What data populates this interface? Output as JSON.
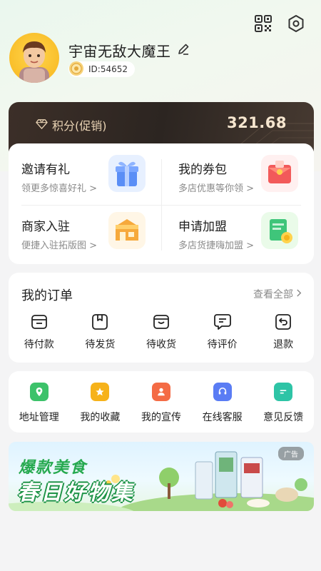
{
  "profile": {
    "username": "宇宙无敌大魔王",
    "id_text": "ID:54652"
  },
  "points": {
    "label": "积分(促销)",
    "value": "321.68"
  },
  "promos": [
    {
      "title": "邀请有礼",
      "subtitle": "领更多惊喜好礼 >"
    },
    {
      "title": "我的券包",
      "subtitle": "多店优惠等你领 >"
    },
    {
      "title": "商家入驻",
      "subtitle": "便捷入驻拓版图 >"
    },
    {
      "title": "申请加盟",
      "subtitle": "多店货捷嗨加盟 >"
    }
  ],
  "orders": {
    "title": "我的订单",
    "view_all": "查看全部",
    "items": [
      {
        "label": "待付款",
        "icon": "wallet-icon"
      },
      {
        "label": "待发货",
        "icon": "package-icon"
      },
      {
        "label": "待收货",
        "icon": "box-icon"
      },
      {
        "label": "待评价",
        "icon": "comment-icon"
      },
      {
        "label": "退款",
        "icon": "refund-icon"
      }
    ]
  },
  "tools": [
    {
      "label": "地址管理",
      "icon": "location-icon",
      "color": "#3cc26a"
    },
    {
      "label": "我的收藏",
      "icon": "star-icon",
      "color": "#f6b21a"
    },
    {
      "label": "我的宣传",
      "icon": "person-icon",
      "color": "#f46b45"
    },
    {
      "label": "在线客服",
      "icon": "headset-icon",
      "color": "#5a7cf4"
    },
    {
      "label": "意见反馈",
      "icon": "feedback-icon",
      "color": "#2ec4a6"
    }
  ],
  "banner": {
    "line1": "爆款美食",
    "line2": "春日好物集",
    "ad_tag": "广告"
  }
}
